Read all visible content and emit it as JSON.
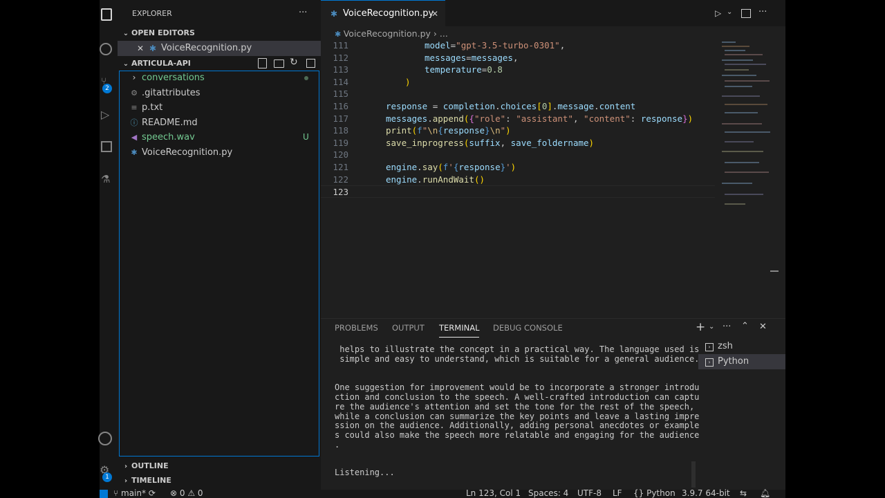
{
  "sidebar": {
    "title": "EXPLORER",
    "more": "···",
    "open_editors_label": "OPEN EDITORS",
    "open_editor_file": "VoiceRecognition.py",
    "folder_label": "ARTICULA-API",
    "files": [
      {
        "name": "conversations",
        "icon": "chevron-right-icon",
        "color": "#73c991",
        "badge": "dot"
      },
      {
        "name": ".gitattributes",
        "icon": "gear-icon",
        "color": "#cccccc"
      },
      {
        "name": "p.txt",
        "icon": "lines-icon",
        "color": "#cccccc"
      },
      {
        "name": "README.md",
        "icon": "info-icon",
        "color": "#cccccc"
      },
      {
        "name": "speech.wav",
        "icon": "audio-icon",
        "color": "#73c991",
        "badge": "U"
      },
      {
        "name": "VoiceRecognition.py",
        "icon": "python-icon",
        "color": "#cccccc"
      }
    ],
    "outline_label": "OUTLINE",
    "timeline_label": "TIMELINE"
  },
  "editor": {
    "tab_label": "VoiceRecognition.py",
    "breadcrumb_file": "VoiceRecognition.py",
    "breadcrumb_more": "...",
    "line_numbers": [
      "111",
      "112",
      "113",
      "114",
      "115",
      "116",
      "117",
      "118",
      "119",
      "120",
      "121",
      "122",
      "123"
    ]
  },
  "panel": {
    "tabs": [
      "PROBLEMS",
      "OUTPUT",
      "TERMINAL",
      "DEBUG CONSOLE"
    ],
    "active_tab": "TERMINAL",
    "terminal_lines": [
      " helps to illustrate the concept in a practical way. The language used is",
      " simple and easy to understand, which is suitable for a general audience.",
      "",
      "",
      "One suggestion for improvement would be to incorporate a stronger introdu",
      "ction and conclusion to the speech. A well-crafted introduction can captu",
      "re the audience's attention and set the tone for the rest of the speech,",
      "while a conclusion can summarize the key points and leave a lasting impre",
      "ssion on the audience. Additionally, adding personal anecdotes or example",
      "s could also make the speech more relatable and engaging for the audience",
      ".",
      "",
      "Listening..."
    ],
    "terminals": [
      "zsh",
      "Python"
    ]
  },
  "statusbar": {
    "branch": "main*",
    "errors": "0",
    "warnings": "0",
    "position": "Ln 123, Col 1",
    "spaces": "Spaces: 4",
    "encoding": "UTF-8",
    "eol": "LF",
    "language": "Python",
    "interpreter": "3.9.7 64-bit"
  },
  "activity": {
    "scm_badge": "2",
    "accounts_badge": "1"
  },
  "colors": {
    "accent": "#0078d4",
    "untracked": "#73c991"
  }
}
